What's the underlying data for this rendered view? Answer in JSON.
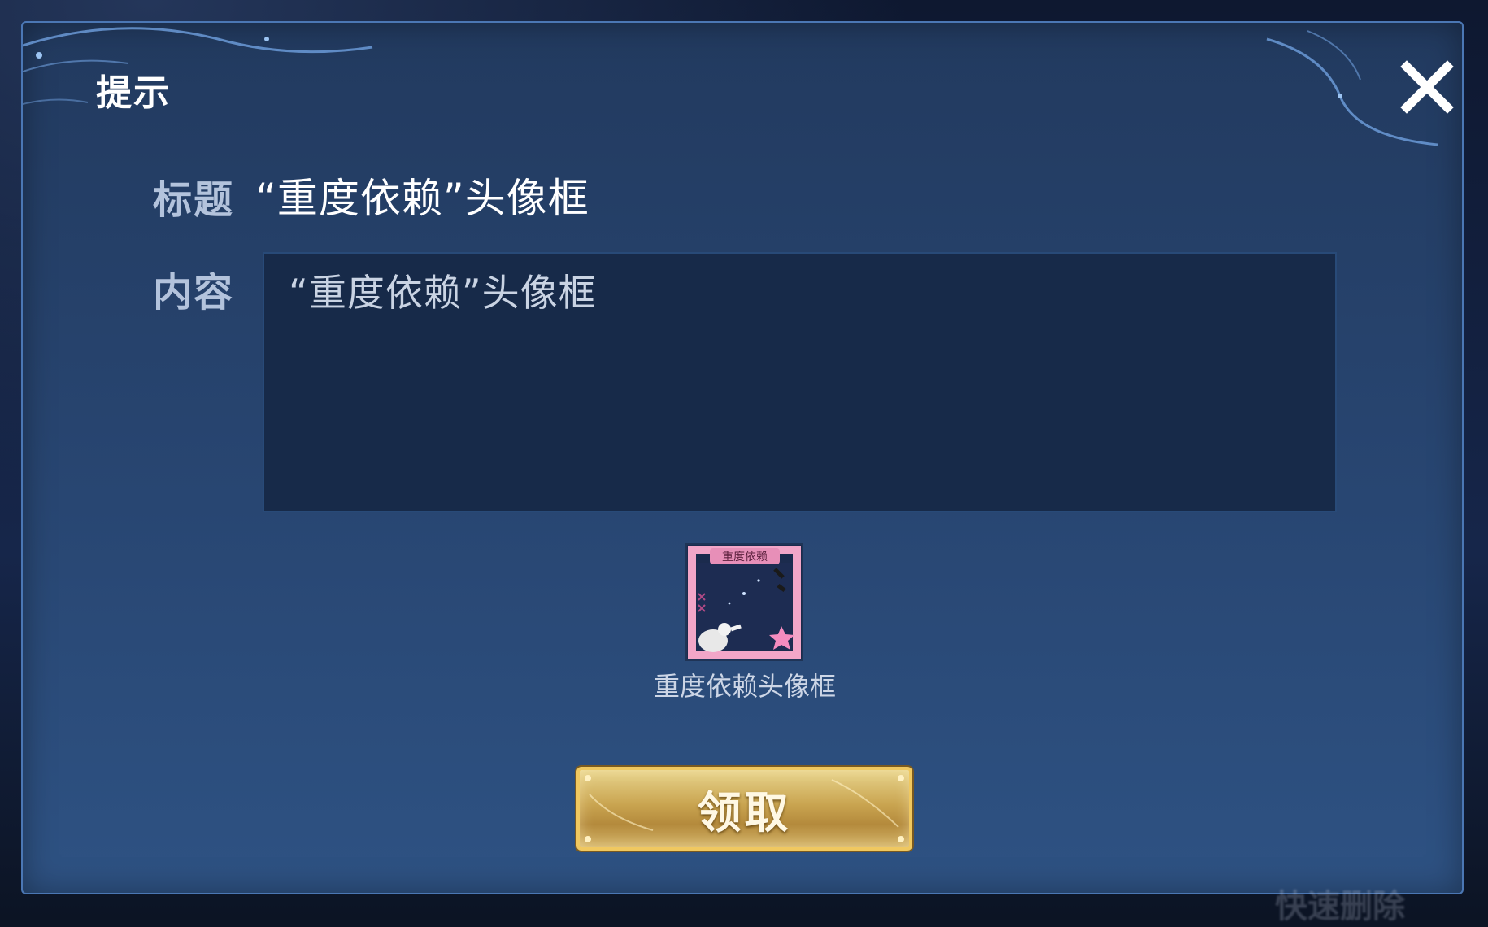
{
  "dialog": {
    "title": "提示",
    "close_icon": "close-icon"
  },
  "mail": {
    "title_label": "标题",
    "title_value": "“重度依赖”头像框",
    "content_label": "内容",
    "content_value": "“重度依赖”头像框"
  },
  "reward": {
    "item_badge_text": "重度依赖",
    "item_name": "重度依赖头像框",
    "item_icon": "avatar-frame-icon"
  },
  "claim_button": {
    "label": "领取"
  },
  "watermark": {
    "text": "快速删除"
  },
  "colors": {
    "dialog_bg": "#284672",
    "dialog_border": "#4b77b4",
    "content_box_bg": "#172a49",
    "button_gold": "#c9a450",
    "frame_pink": "#f2a6c8"
  }
}
